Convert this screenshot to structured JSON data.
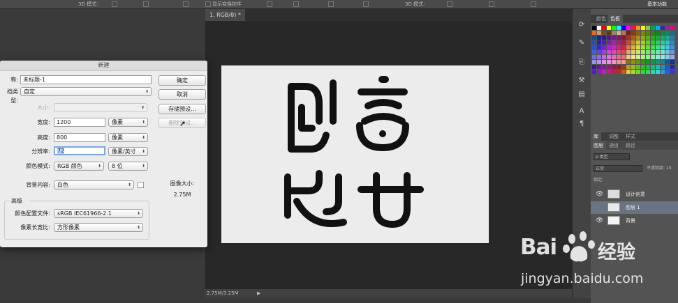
{
  "options_bar": {
    "mode_label": "3D 模式:",
    "mode_label_2": "3D 模式:",
    "show_transform": "显示变换控件",
    "mode_label_3": "3D 模式:",
    "right_label": "基本功能"
  },
  "document": {
    "tab_title": "1, RGB/8) *",
    "status": "2.75M/3.25M",
    "canvas_text": [
      "创",
      "意",
      "设",
      "计"
    ]
  },
  "swatch_panel": {
    "tabs": [
      "颜色",
      "色板"
    ],
    "colors": [
      "#000000",
      "#ffffff",
      "#ff0000",
      "#ffff00",
      "#00ff00",
      "#00ffff",
      "#0000ff",
      "#ff00ff",
      "#ed1c24",
      "#f7941d",
      "#fff200",
      "#8dc63f",
      "#00a651",
      "#00aeef",
      "#2e3192",
      "#92278f",
      "#ec008c",
      "#f26522",
      "#c69c6d",
      "#754c24",
      "#603913",
      "#998675",
      "#c7b299",
      "#a67c52"
    ]
  },
  "layers_panel": {
    "top_tabs": [
      "库",
      "调整",
      "样式"
    ],
    "tabs": [
      "图层",
      "通道",
      "路径"
    ],
    "kind_label": "ρ 类型",
    "blend_mode": "正常",
    "opacity_label": "不透明度: 10",
    "lock_label": "锁定:",
    "layers": [
      {
        "name": "设计创意",
        "selected": false
      },
      {
        "name": "图层 1",
        "selected": true
      },
      {
        "name": "背景",
        "selected": false
      }
    ]
  },
  "dialog": {
    "title": "新建",
    "name_label": "称:",
    "name_value": "未标题-1",
    "preset_label": "档类型:",
    "preset_value": "自定",
    "size_label": "大小:",
    "width_label": "宽度:",
    "width_value": "1200",
    "width_unit": "像素",
    "height_label": "高度:",
    "height_value": "800",
    "height_unit": "像素",
    "res_label": "分辨率:",
    "res_value": "72",
    "res_unit": "像素/英寸",
    "color_mode_label": "颜色模式:",
    "color_mode_value": "RGB 颜色",
    "bit_value": "8 位",
    "bg_label": "背景内容:",
    "bg_value": "白色",
    "advanced_label": "高级",
    "profile_label": "颜色配置文件:",
    "profile_value": "sRGB IEC61966-2.1",
    "aspect_label": "像素长宽比:",
    "aspect_value": "方形像素",
    "image_size_label": "图像大小:",
    "image_size_value": "2.75M",
    "buttons": {
      "ok": "确定",
      "cancel": "取消",
      "save_preset": "存储预设...",
      "delete_preset": "删除预设..."
    }
  },
  "watermark": {
    "logo": "Bai",
    "logo_suffix": "经验",
    "url": "jingyan.baidu.com"
  }
}
